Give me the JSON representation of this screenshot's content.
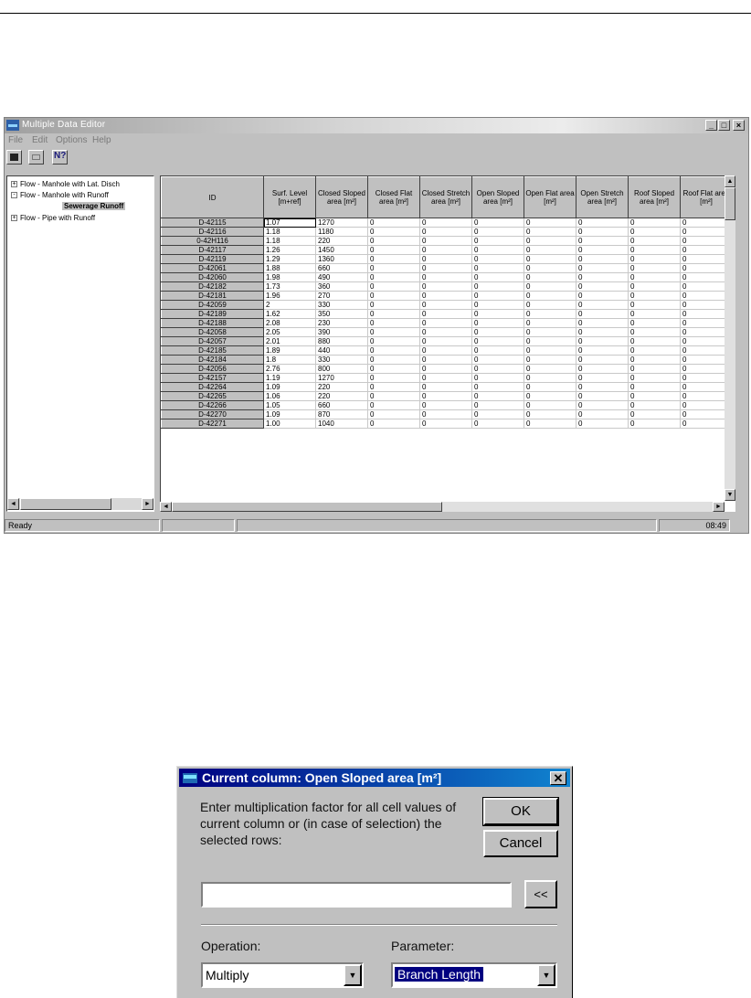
{
  "window": {
    "title": "Multiple Data Editor",
    "menu": [
      "File",
      "Edit",
      "Options",
      "Help"
    ],
    "tree": [
      {
        "label": "Flow - Manhole with Lat. Disch",
        "expander": "+"
      },
      {
        "label": "Flow - Manhole with Runoff",
        "expander": "-"
      },
      {
        "label": "Sewerage Runoff",
        "expander": ""
      },
      {
        "label": "Flow - Pipe with Runoff",
        "expander": "+"
      }
    ],
    "columns": [
      "ID",
      "Surf. Level [m+ref]",
      "Closed Sloped area [m²]",
      "Closed Flat area [m²]",
      "Closed Stretch area [m²]",
      "Open Sloped area [m²]",
      "Open Flat area [m²]",
      "Open Stretch area [m²]",
      "Roof Sloped area [m²]",
      "Roof Flat area [m²]"
    ],
    "rows": [
      [
        "D-42115",
        "1.07",
        "1270",
        "0",
        "0",
        "0",
        "0",
        "0",
        "0",
        "0"
      ],
      [
        "D-42116",
        "1.18",
        "1180",
        "0",
        "0",
        "0",
        "0",
        "0",
        "0",
        "0"
      ],
      [
        "0-42H116",
        "1.18",
        "220",
        "0",
        "0",
        "0",
        "0",
        "0",
        "0",
        "0"
      ],
      [
        "D-42117",
        "1.26",
        "1450",
        "0",
        "0",
        "0",
        "0",
        "0",
        "0",
        "0"
      ],
      [
        "D-42119",
        "1.29",
        "1360",
        "0",
        "0",
        "0",
        "0",
        "0",
        "0",
        "0"
      ],
      [
        "D-42061",
        "1.88",
        "660",
        "0",
        "0",
        "0",
        "0",
        "0",
        "0",
        "0"
      ],
      [
        "D-42060",
        "1.98",
        "490",
        "0",
        "0",
        "0",
        "0",
        "0",
        "0",
        "0"
      ],
      [
        "D-42182",
        "1.73",
        "360",
        "0",
        "0",
        "0",
        "0",
        "0",
        "0",
        "0"
      ],
      [
        "D-42181",
        "1.96",
        "270",
        "0",
        "0",
        "0",
        "0",
        "0",
        "0",
        "0"
      ],
      [
        "D-42059",
        "2",
        "330",
        "0",
        "0",
        "0",
        "0",
        "0",
        "0",
        "0"
      ],
      [
        "D-42189",
        "1.62",
        "350",
        "0",
        "0",
        "0",
        "0",
        "0",
        "0",
        "0"
      ],
      [
        "D-42188",
        "2.08",
        "230",
        "0",
        "0",
        "0",
        "0",
        "0",
        "0",
        "0"
      ],
      [
        "D-42058",
        "2.05",
        "390",
        "0",
        "0",
        "0",
        "0",
        "0",
        "0",
        "0"
      ],
      [
        "D-42057",
        "2.01",
        "880",
        "0",
        "0",
        "0",
        "0",
        "0",
        "0",
        "0"
      ],
      [
        "D-42185",
        "1.89",
        "440",
        "0",
        "0",
        "0",
        "0",
        "0",
        "0",
        "0"
      ],
      [
        "D-42184",
        "1.8",
        "330",
        "0",
        "0",
        "0",
        "0",
        "0",
        "0",
        "0"
      ],
      [
        "D-42056",
        "2.76",
        "800",
        "0",
        "0",
        "0",
        "0",
        "0",
        "0",
        "0"
      ],
      [
        "D-42157",
        "1.19",
        "1270",
        "0",
        "0",
        "0",
        "0",
        "0",
        "0",
        "0"
      ],
      [
        "D-42264",
        "1.09",
        "220",
        "0",
        "0",
        "0",
        "0",
        "0",
        "0",
        "0"
      ],
      [
        "D-42265",
        "1.06",
        "220",
        "0",
        "0",
        "0",
        "0",
        "0",
        "0",
        "0"
      ],
      [
        "D-42266",
        "1.05",
        "660",
        "0",
        "0",
        "0",
        "0",
        "0",
        "0",
        "0"
      ],
      [
        "D-42270",
        "1.09",
        "870",
        "0",
        "0",
        "0",
        "0",
        "0",
        "0",
        "0"
      ],
      [
        "D-42271",
        "1.00",
        "1040",
        "0",
        "0",
        "0",
        "0",
        "0",
        "0",
        "0"
      ]
    ],
    "status": {
      "text": "Ready",
      "time": "08:49"
    }
  },
  "dialog": {
    "title": "Current column: Open Sloped area [m²]",
    "message": "Enter multiplication factor for all cell values of current column or (in case of selection) the selected rows:",
    "ok_label": "OK",
    "cancel_label": "Cancel",
    "factor_value": "",
    "back_label": "<<",
    "operation_label": "Operation:",
    "operation_value": "Multiply",
    "parameter_label": "Parameter:",
    "parameter_value": "Branch Length"
  }
}
